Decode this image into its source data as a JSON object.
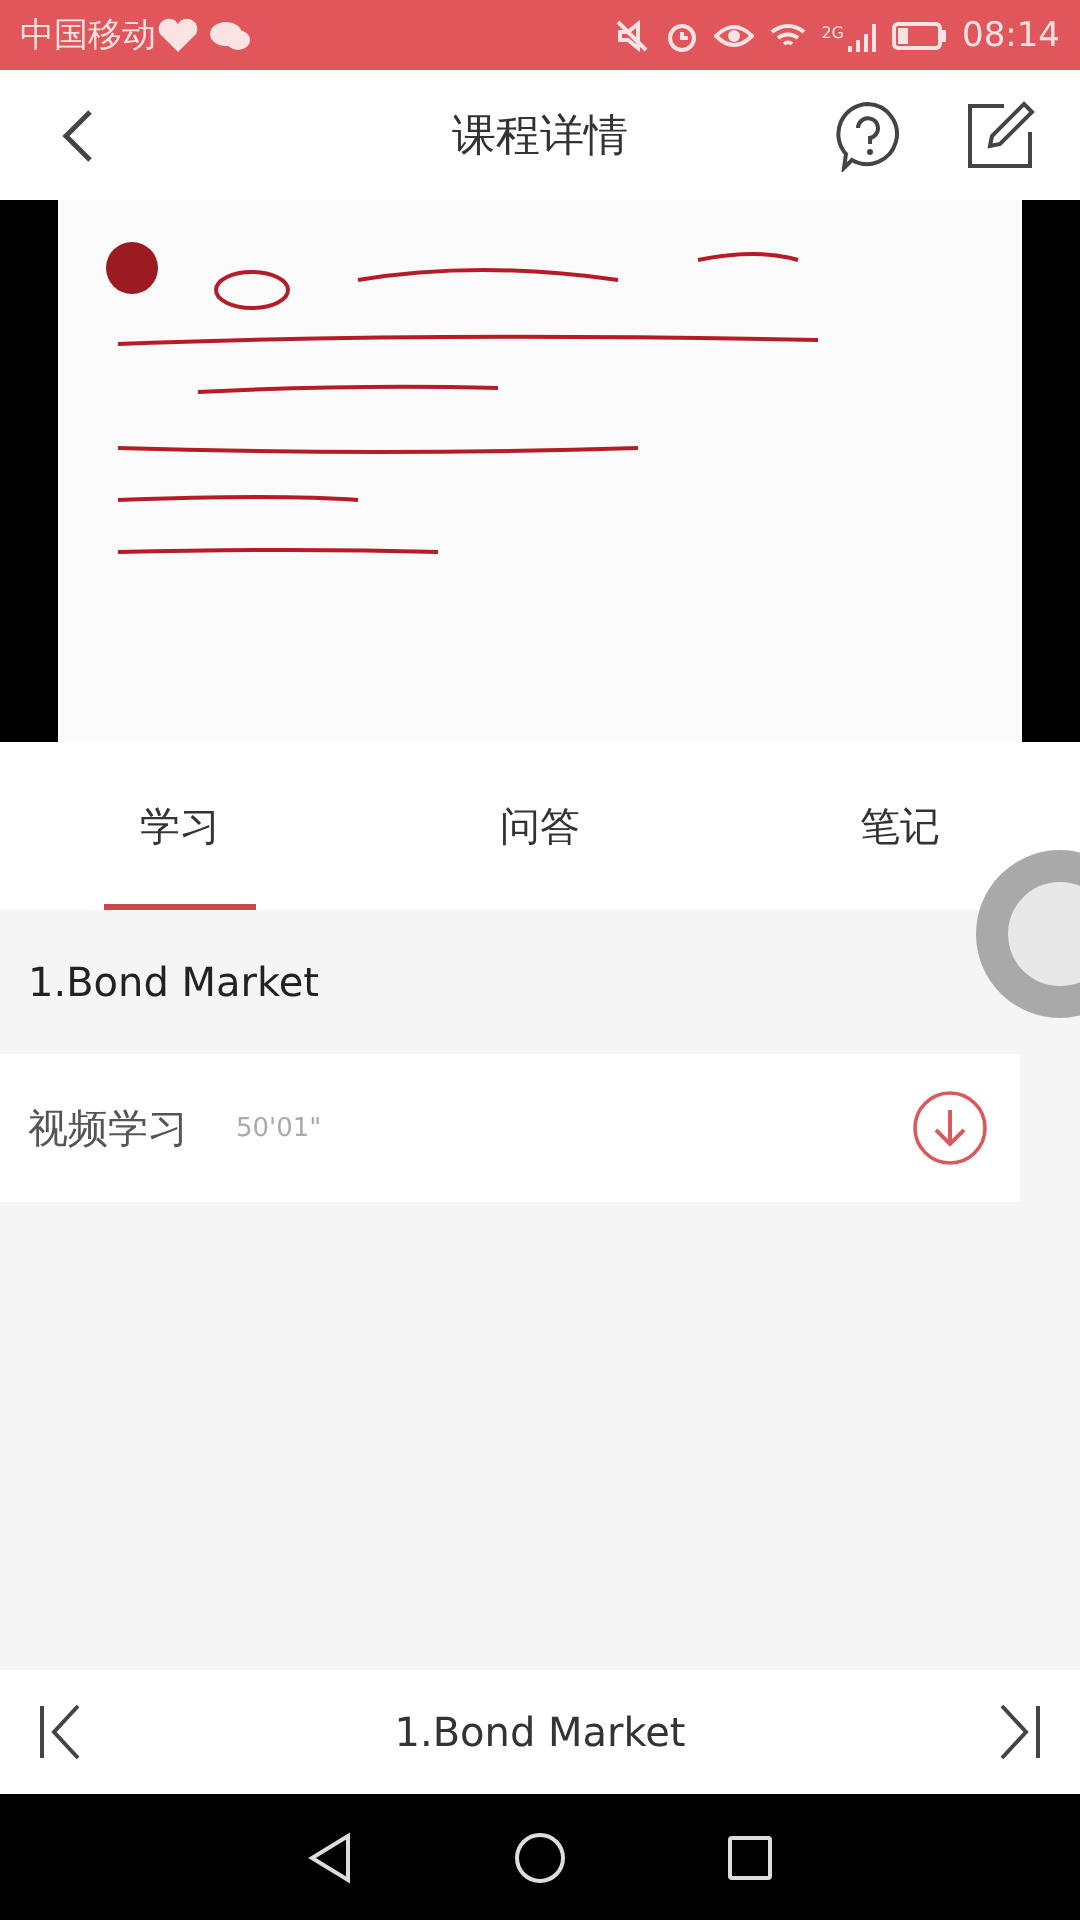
{
  "status_bar": {
    "carrier": "中国移动",
    "network": "2G",
    "time": "08:14"
  },
  "header": {
    "title": "课程详情"
  },
  "tabs": [
    {
      "label": "学习",
      "selected": true
    },
    {
      "label": "问答",
      "selected": false
    },
    {
      "label": "笔记",
      "selected": false
    }
  ],
  "section": {
    "title": "1.Bond Market"
  },
  "lessons": [
    {
      "title": "视频学习",
      "duration": "50'01\""
    }
  ],
  "bottom_bar": {
    "title": "1.Bond Market"
  }
}
